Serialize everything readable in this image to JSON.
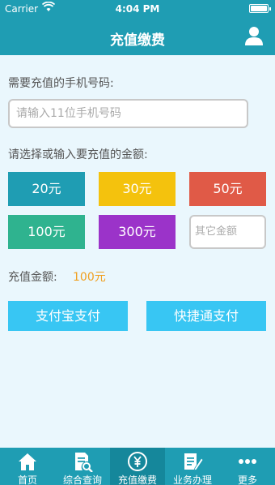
{
  "status_bar": {
    "carrier": "Carrier",
    "time": "4:04 PM"
  },
  "nav": {
    "title": "充值缴费",
    "user_icon": "user-icon"
  },
  "form": {
    "phone_label": "需要充值的手机号码:",
    "phone_placeholder": "请输入11位手机号码",
    "amount_label": "请选择或输入要充值的金额:",
    "amounts": [
      {
        "label": "20元",
        "color": "#1f9db3"
      },
      {
        "label": "30元",
        "color": "#f4c20d"
      },
      {
        "label": "50元",
        "color": "#e05a47"
      },
      {
        "label": "100元",
        "color": "#2fb38f"
      },
      {
        "label": "300元",
        "color": "#9b33c9"
      }
    ],
    "other_placeholder": "其它金额",
    "total_label": "充值金额:",
    "total_value": "100元"
  },
  "buttons": {
    "alipay": "支付宝支付",
    "quickpay": "快捷通支付",
    "color": "#38c6f3"
  },
  "tabs": [
    {
      "label": "首页",
      "icon": "home-icon"
    },
    {
      "label": "综合查询",
      "icon": "document-search-icon"
    },
    {
      "label": "充值缴费",
      "icon": "yuan-coin-icon",
      "active": true
    },
    {
      "label": "业务办理",
      "icon": "edit-form-icon"
    },
    {
      "label": "更多",
      "icon": "more-dots-icon"
    }
  ],
  "colors": {
    "primary": "#1f9db3",
    "background": "#eaf7fd",
    "amount_text": "#f0a020"
  }
}
